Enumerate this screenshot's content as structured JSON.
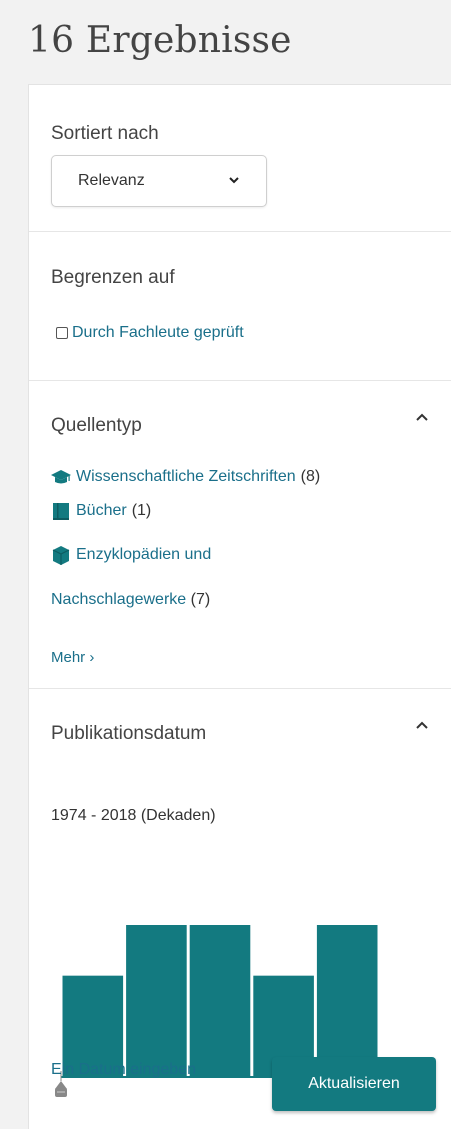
{
  "header": {
    "results_title": "16 Ergebnisse"
  },
  "sort": {
    "label": "Sortiert nach",
    "selected": "Relevanz"
  },
  "limit": {
    "label": "Begrenzen auf",
    "peer_review_label": "Durch Fachleute geprüft",
    "peer_review_checked": false
  },
  "source_type": {
    "title": "Quellentyp",
    "items": [
      {
        "label": "Wissenschaftliche Zeitschriften",
        "count": "(8)",
        "icon": "mortarboard-icon"
      },
      {
        "label": "Bücher",
        "count": "(1)",
        "icon": "book-icon"
      },
      {
        "label": "Enzyklopädien und",
        "label_line2": "Nachschlagewerke",
        "count": "(7)",
        "icon": "encyclopedia-icon"
      }
    ],
    "more_label": "Mehr ›"
  },
  "publication_date": {
    "title": "Publikationsdatum",
    "range_label": "1974 - 2018 (Dekaden)",
    "enter_date_label": "Ein Datum eingeben",
    "update_button": "Aktualisieren"
  },
  "colors": {
    "accent": "#137a80",
    "link": "#1a6f8a"
  },
  "chart_data": {
    "type": "bar",
    "bars": 5,
    "values": [
      2,
      3,
      3,
      2,
      3
    ],
    "ylim": [
      0,
      3
    ],
    "title": "",
    "xlabel": "",
    "ylabel": "",
    "grid": false,
    "legend": "none"
  }
}
